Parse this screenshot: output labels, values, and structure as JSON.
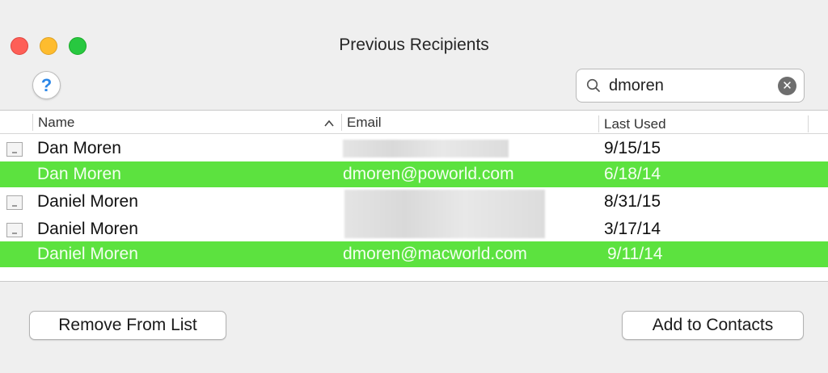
{
  "window": {
    "title": "Previous Recipients"
  },
  "toolbar": {
    "help_label": "?",
    "search": {
      "value": "dmoren",
      "placeholder": ""
    },
    "clear_label": "✕"
  },
  "table": {
    "columns": {
      "name": "Name",
      "email": "Email",
      "last_used": "Last Used"
    },
    "sort_indicator": "^",
    "rows": [
      {
        "name": "Dan Moren",
        "email": "",
        "last_used": "9/15/15",
        "selected": false
      },
      {
        "name": "Dan Moren",
        "email": "dmoren@poworld.com",
        "last_used": "6/18/14",
        "selected": true
      },
      {
        "name": "Daniel Moren",
        "email": "",
        "last_used": "8/31/15",
        "selected": false
      },
      {
        "name": "Daniel Moren",
        "email": "",
        "last_used": "3/17/14",
        "selected": false
      },
      {
        "name": "Daniel Moren",
        "email": "dmoren@macworld.com",
        "last_used": "9/11/14",
        "selected": true
      }
    ]
  },
  "buttons": {
    "remove": "Remove From List",
    "add": "Add to Contacts"
  },
  "colors": {
    "selection": "#5ce23f",
    "close": "#fe5f57",
    "minimize": "#febc2e",
    "zoom": "#28c840",
    "help_accent": "#2c87e8"
  }
}
